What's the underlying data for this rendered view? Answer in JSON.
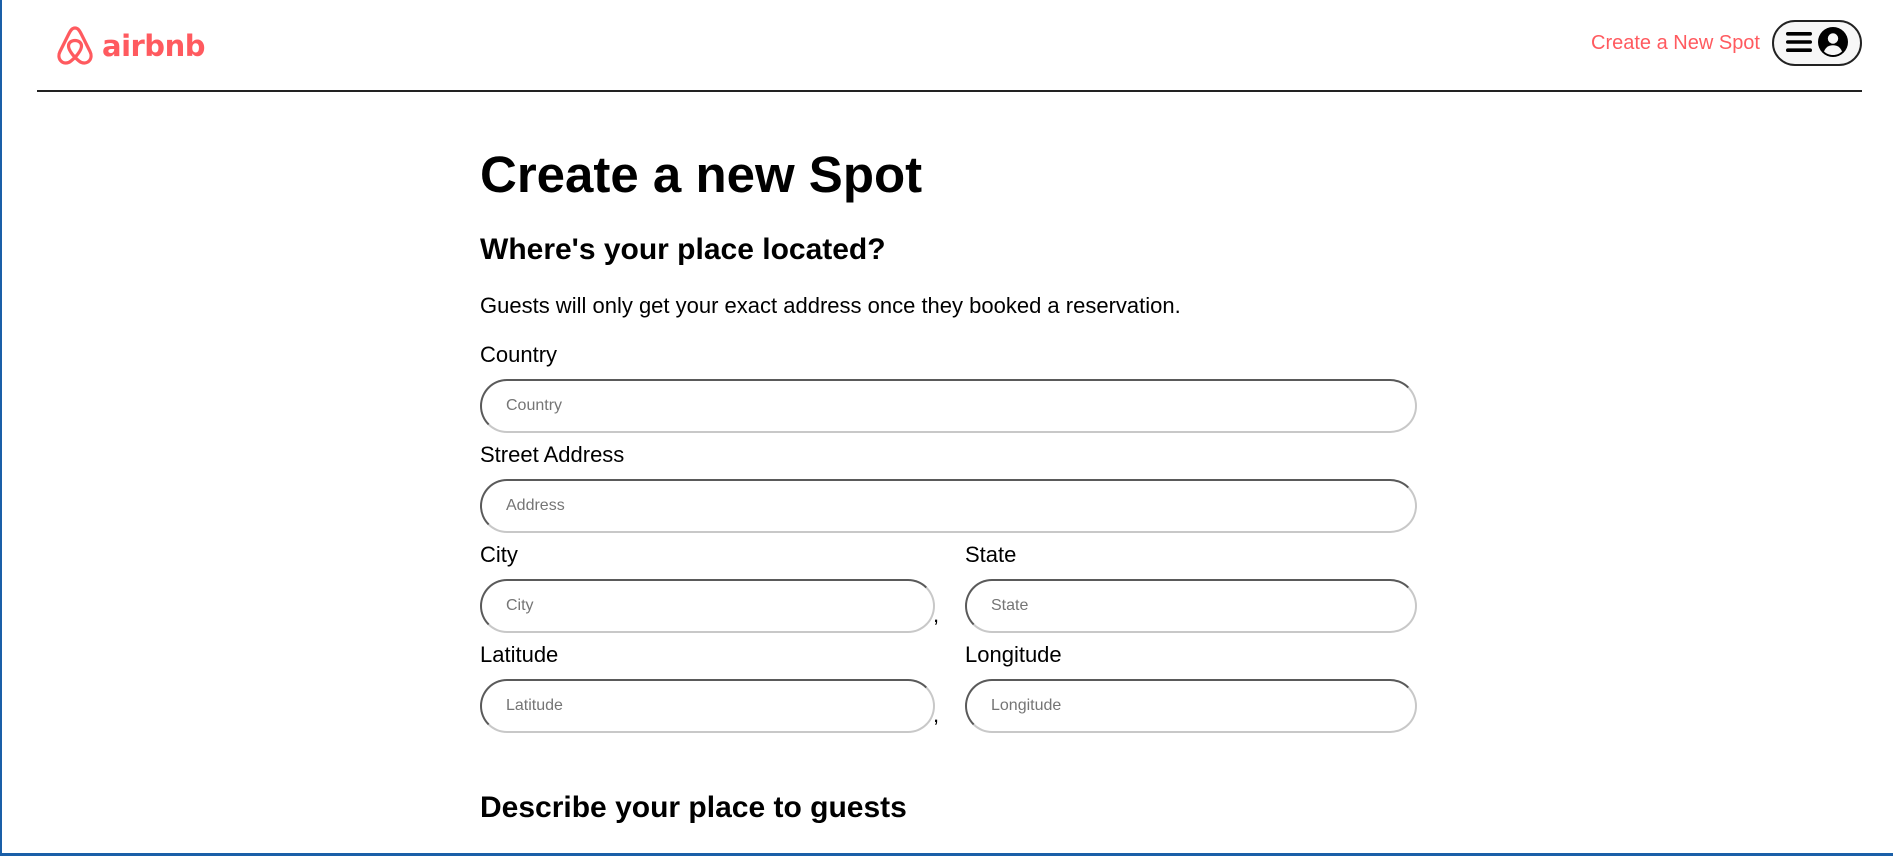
{
  "header": {
    "logo_text": "airbnb",
    "create_spot_link": "Create a New Spot"
  },
  "form": {
    "title": "Create a new Spot",
    "location_section": {
      "heading": "Where's your place located?",
      "description": "Guests will only get your exact address once they booked a reservation.",
      "country": {
        "label": "Country",
        "placeholder": "Country",
        "value": ""
      },
      "street": {
        "label": "Street Address",
        "placeholder": "Address",
        "value": ""
      },
      "city": {
        "label": "City",
        "placeholder": "City",
        "value": ""
      },
      "state": {
        "label": "State",
        "placeholder": "State",
        "value": ""
      },
      "latitude": {
        "label": "Latitude",
        "placeholder": "Latitude",
        "value": ""
      },
      "longitude": {
        "label": "Longitude",
        "placeholder": "Longitude",
        "value": ""
      },
      "separator": ","
    },
    "describe_section": {
      "heading": "Describe your place to guests"
    }
  },
  "colors": {
    "brand": "#ff5a5f",
    "text": "#000000",
    "border_dark": "#5a5a5a",
    "border_light": "#c8c8c8"
  },
  "icons": {
    "logo": "airbnb-belo-icon",
    "menu": "hamburger-icon",
    "profile": "user-circle-icon"
  }
}
